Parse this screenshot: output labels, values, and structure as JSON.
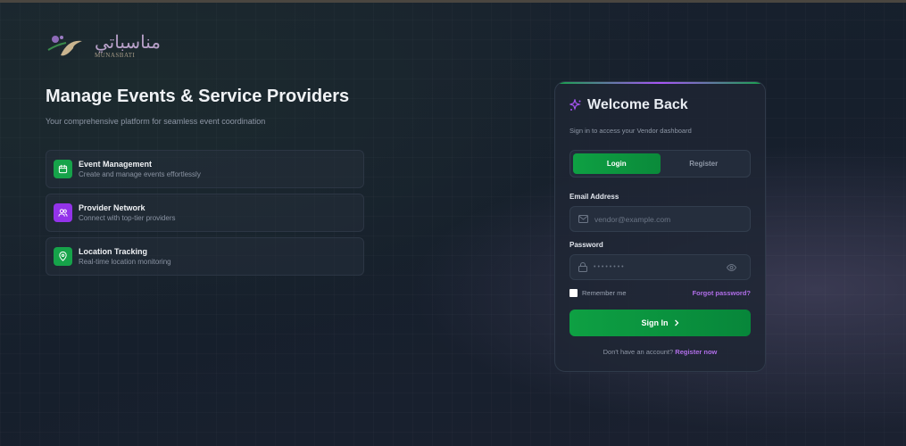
{
  "logo": {
    "arabic": "مناسباتي",
    "latin": "MUNASBATI"
  },
  "hero": {
    "title": "Manage Events & Service Providers",
    "subtitle": "Your comprehensive platform for seamless event coordination"
  },
  "features": [
    {
      "title": "Event Management",
      "desc": "Create and manage events effortlessly",
      "icon": "calendar-icon",
      "color": "#16a34a"
    },
    {
      "title": "Provider Network",
      "desc": "Connect with top-tier providers",
      "icon": "users-icon",
      "color": "#9333ea"
    },
    {
      "title": "Location Tracking",
      "desc": "Real-time location monitoring",
      "icon": "map-pin-icon",
      "color": "#16a34a"
    }
  ],
  "card": {
    "title": "Welcome Back",
    "subtitle": "Sign in to access your Vendor dashboard",
    "tabs": {
      "login": "Login",
      "register": "Register"
    },
    "email_label": "Email Address",
    "email_placeholder": "vendor@example.com",
    "password_label": "Password",
    "password_value": "••••••••",
    "remember": "Remember me",
    "forgot": "Forgot password?",
    "signin": "Sign In",
    "no_account": "Don't have an account?",
    "register_now": "Register now"
  }
}
